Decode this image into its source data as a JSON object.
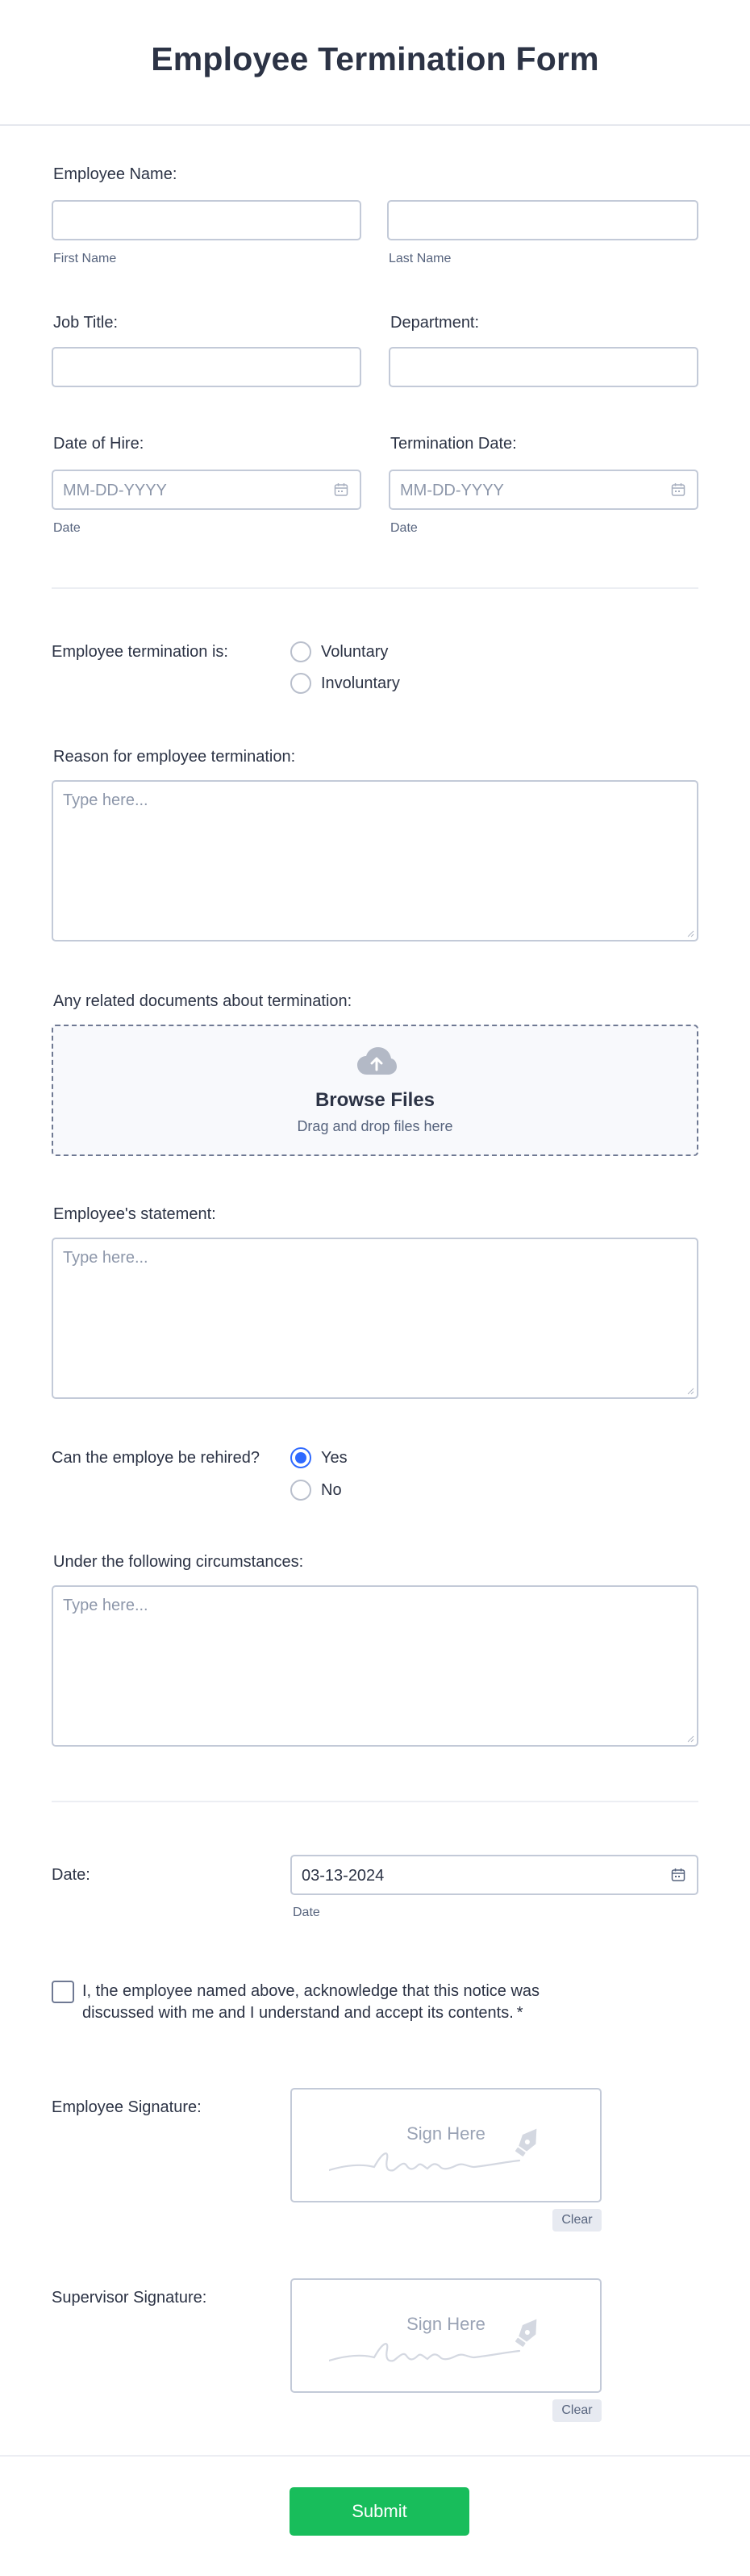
{
  "form": {
    "title": "Employee Termination Form",
    "employee_name": {
      "label": "Employee Name:",
      "first_sublabel": "First Name",
      "last_sublabel": "Last Name",
      "first_value": "",
      "last_value": ""
    },
    "job_title": {
      "label": "Job Title:",
      "value": ""
    },
    "department": {
      "label": "Department:",
      "value": ""
    },
    "date_of_hire": {
      "label": "Date of Hire:",
      "placeholder": "MM-DD-YYYY",
      "sublabel": "Date"
    },
    "termination_date": {
      "label": "Termination Date:",
      "placeholder": "MM-DD-YYYY",
      "sublabel": "Date"
    },
    "termination_type": {
      "label": "Employee termination is:",
      "options": [
        "Voluntary",
        "Involuntary"
      ],
      "selected": null
    },
    "reason": {
      "label": "Reason for employee termination:",
      "placeholder": "Type here..."
    },
    "documents": {
      "label": "Any related documents about termination:",
      "browse_label": "Browse Files",
      "drag_text": "Drag and drop files here",
      "icon": "cloud-upload-icon"
    },
    "statement": {
      "label": "Employee's statement:",
      "placeholder": "Type here..."
    },
    "rehire": {
      "label": "Can the employe be rehired?",
      "options": [
        "Yes",
        "No"
      ],
      "selected": "Yes"
    },
    "circumstances": {
      "label": "Under the following circumstances:",
      "placeholder": "Type here..."
    },
    "date": {
      "label": "Date:",
      "value": "03-13-2024",
      "sublabel": "Date"
    },
    "acknowledge": {
      "text": "I, the employee named above, acknowledge that this notice was discussed with me and I understand and accept its contents.",
      "required_mark": "*",
      "checked": false
    },
    "employee_signature": {
      "label": "Employee Signature:",
      "placeholder": "Sign Here",
      "clear_label": "Clear"
    },
    "supervisor_signature": {
      "label": "Supervisor Signature:",
      "placeholder": "Sign Here",
      "clear_label": "Clear"
    },
    "submit_label": "Submit"
  },
  "colors": {
    "accent": "#2e69ff",
    "submit": "#18bd5b",
    "text": "#2c3345",
    "border": "#c3cad8"
  }
}
